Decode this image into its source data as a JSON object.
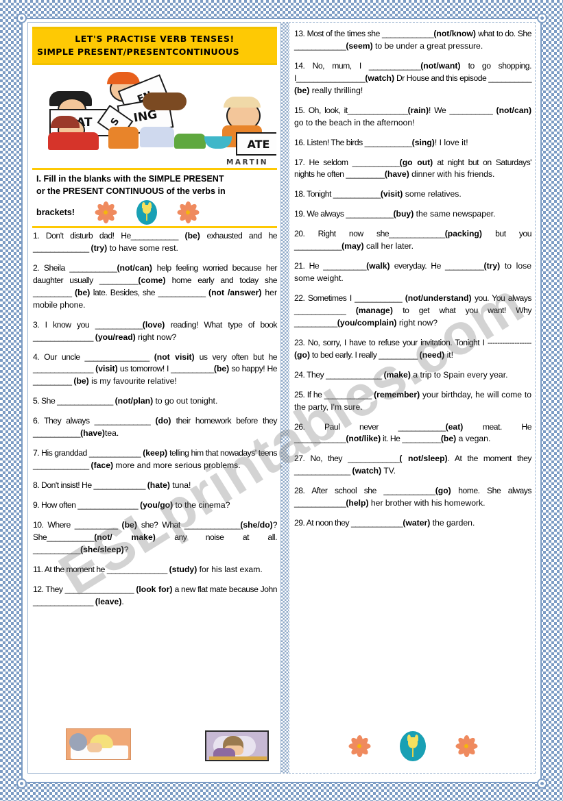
{
  "worksheet": {
    "title_line1": "LET'S PRACTISE VERB TENSES!",
    "title_line2": "SIMPLE PRESENT/PRESENTCONTINUOUS",
    "instruction_line1": "I. Fill in the blanks with the SIMPLE PRESENT",
    "instruction_line2": "or the PRESENT CONTINUOUS of the verbs in",
    "instruction_line3": "brackets!",
    "watermark": "ESLprintables.com",
    "artist_credit": "MARTIN",
    "accent_yellow": "#fec904",
    "border_blue": "#7c9cc4"
  },
  "header_art": {
    "sign_eat": "EAT",
    "sign_en": "EN",
    "sign_ing": "ING",
    "sign_s": "S",
    "sign_ate": "ATE"
  },
  "left_column": {
    "items": [
      "1. Don't disturb dad! He___________ (be) exhausted and he _____________ (try) to have some rest.",
      "2. Sheila ___________(not/can) help feeling worried because her daughter usually _________(come) home early and today she _________ (be) late. Besides, she ___________ (not /answer) her mobile phone.",
      "3. I know you ___________(love) reading! What type of book ______________ (you/read) right now?",
      "4. Our uncle _______________ (not visit) us very often but he ______________ (visit) us tomorrow! I __________(be) so happy! He _________ (be) is my favourite relative!",
      "5. She _____________ (not/plan) to go out tonight.",
      "6. They always _____________ (do) their homework before they ___________(have)tea.",
      "7. His granddad ____________ (keep) telling him that nowadays' teens _____________ (face) more and more serious problems.",
      "8. Don't insist! He ____________ (hate) tuna!",
      "9. How often ______________ (you/go) to the cinema?",
      "10. Where __________ (be) she? What _____________(she/do)?She___________(not/ make) any noise at all. ___________(she/sleep)?",
      "11. At the moment he ______________ (study) for his last exam.",
      "12. They ________________ (look for) a new flat mate because John ______________ (leave)."
    ]
  },
  "right_column": {
    "items": [
      "13. Most of the times she ____________(not/know) what to do. She ____________(seem) to be under a great pressure.",
      "14. No, mum, I ____________(not/want) to go shopping. I________________(watch) Dr House and this episode __________ (be) really thrilling!",
      "15. Oh, look, it______________(rain)! We __________ (not/can) go to the beach in the afternoon!",
      "16. Listen! The birds ___________(sing)! I love it!",
      "17. He seldom ___________(go out) at night but on Saturdays' nights he often _________(have) dinner with his friends.",
      "18. Tonight ___________(visit) some relatives.",
      "19. We always ___________(buy) the same newspaper.",
      "20. Right now she_____________(packing) but you ___________(may) call her later.",
      "21. He __________(walk) everyday. He _________(try) to lose some weight.",
      "22. Sometimes I ___________ (not/understand) you. You always ____________ (manage) to get what you want! Why __________(you/complain) right now?",
      "23. No, sorry, I have to refuse your invitation. Tonight I ------------------(go) to bed early. I really _________ (need) it!",
      "24. They _____________ (make) a trip to Spain every year.",
      "25. If he ___________ (remember) your birthday, he will come to the party, I'm sure.",
      "26. Paul never ___________(eat) meat. He ____________(not/like) it. He _________(be) a vegan.",
      "27. No, they ____________( not/sleep). At the moment they _____________ (watch) TV.",
      "28. After school she ____________(go) home. She always ____________(help) her brother with his homework.",
      "29. At noon they ____________(water) the garden."
    ]
  },
  "bottom_art": {
    "left_image_alt": "girl-sleeping-on-desk",
    "right_image_alt": "boy-sleeping-on-book",
    "flower_left_alt": "orange-flower",
    "tulip_alt": "yellow-tulip-oval",
    "flower_right_alt": "orange-flower"
  }
}
